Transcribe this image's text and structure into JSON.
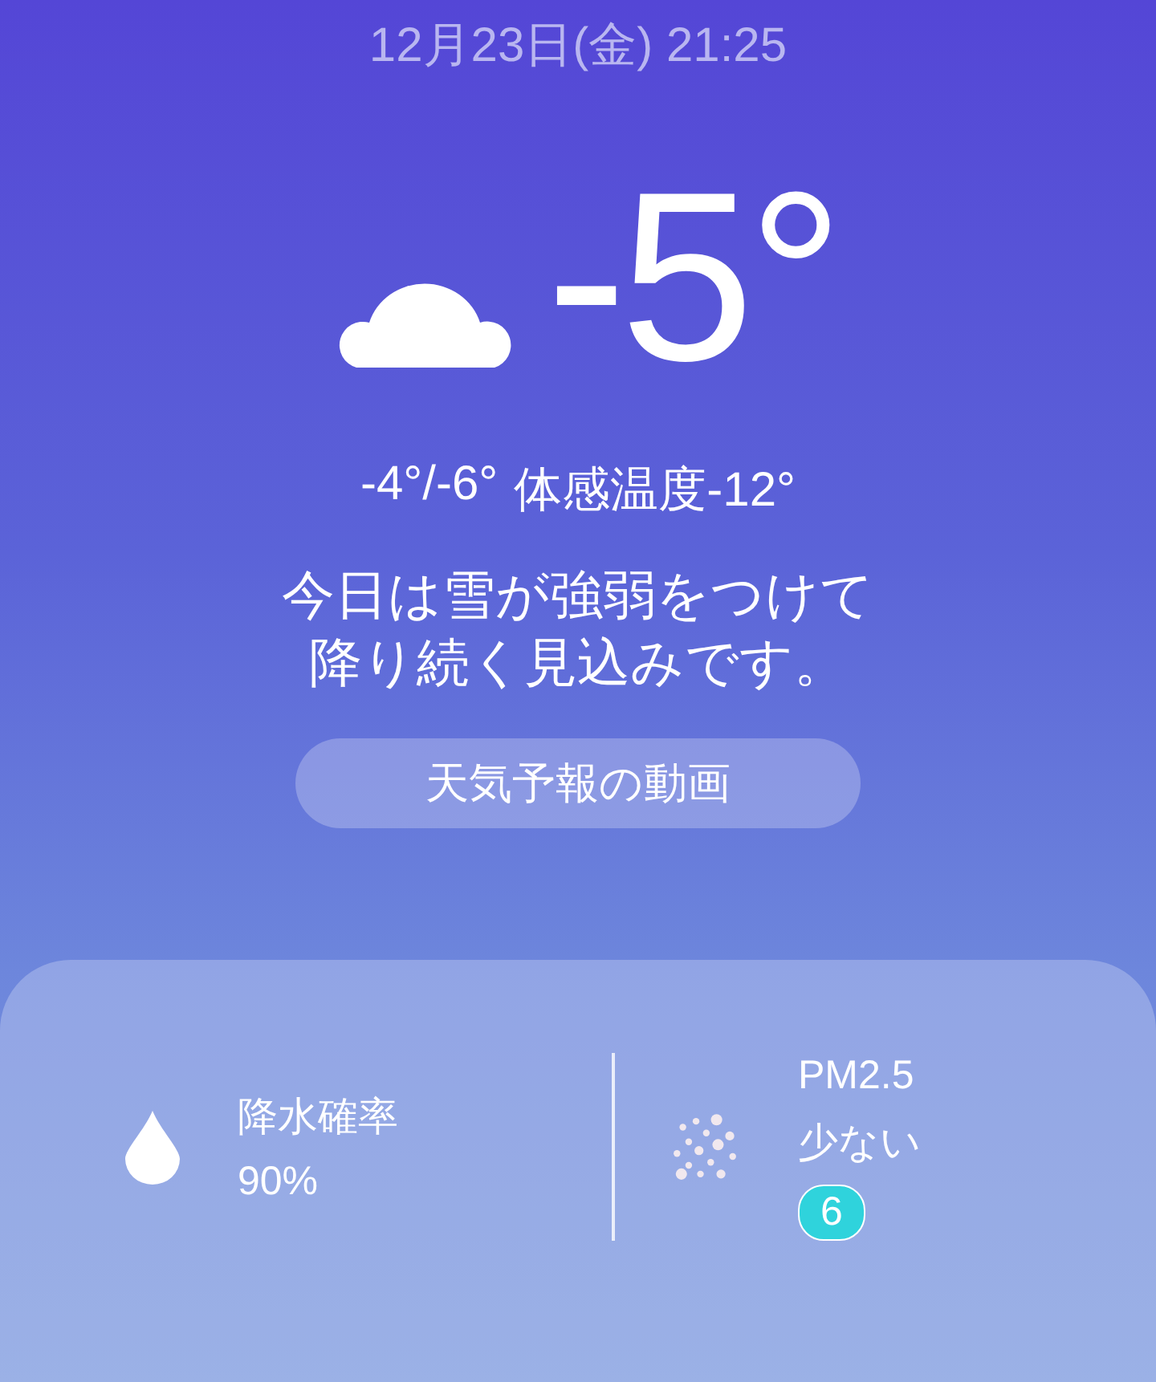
{
  "datetime": "12月23日(金) 21:25",
  "current": {
    "temperature": "-5°",
    "high_low": "-4°/-6°",
    "feels_like": "体感温度-12°",
    "description": "今日は雪が強弱をつけて降り続く見込みです。"
  },
  "video_button": {
    "label": "天気予報の動画"
  },
  "details": [
    {
      "kind": "precipitation",
      "label": "降水確率",
      "value": "90%"
    },
    {
      "kind": "pm25",
      "label": "PM2.5",
      "value": "少ない",
      "index": "6"
    }
  ]
}
